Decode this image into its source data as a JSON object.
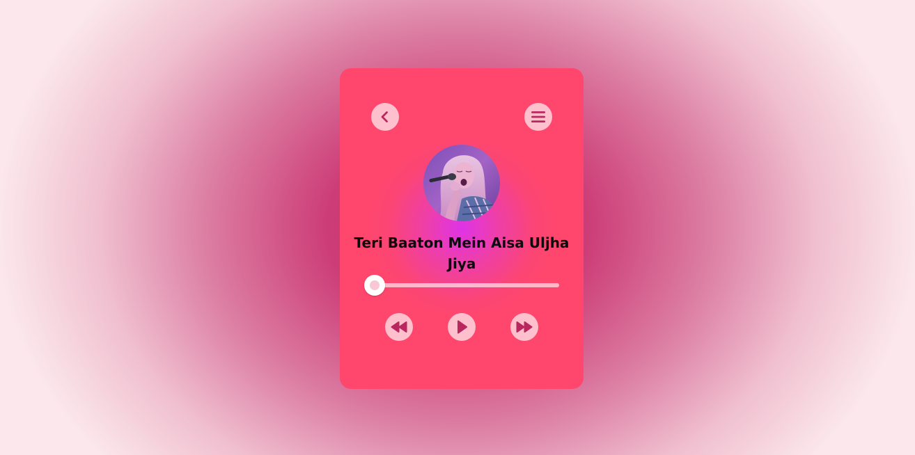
{
  "player": {
    "song_title": "Teri Baaton Mein Aisa Uljha Jiya",
    "progress": 0,
    "album_art": "singer-with-microphone-image"
  },
  "controls": {
    "back_icon": "chevron-left-icon",
    "menu_icon": "hamburger-menu-icon",
    "prev_icon": "rewind-icon",
    "play_icon": "play-icon",
    "next_icon": "fast-forward-icon"
  },
  "colors": {
    "card_background": "#ff466c",
    "button_background": "#ffdce4",
    "icon_color": "#c2185b",
    "title_color": "#0e0a0d",
    "glow_color": "#dd32ee"
  }
}
